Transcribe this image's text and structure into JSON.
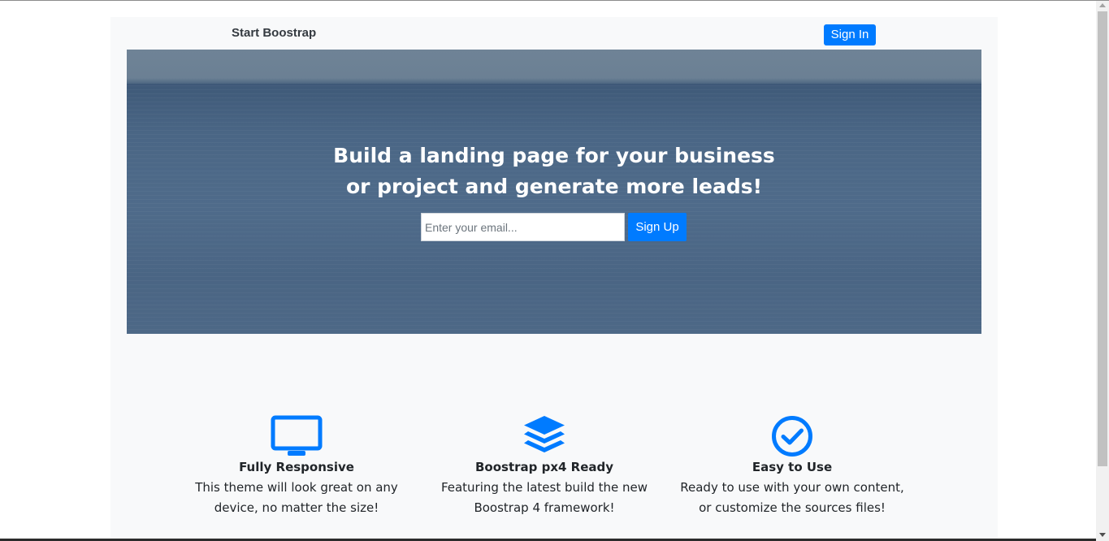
{
  "navbar": {
    "brand": "Start Boostrap",
    "signin_label": "Sign In"
  },
  "hero": {
    "headline_line1": "Build a landing page for your business",
    "headline_line2": "or project and generate more leads!",
    "email_placeholder": "Enter your email...",
    "signup_label": "Sign Up"
  },
  "features": [
    {
      "icon": "desktop-icon",
      "title": "Fully Responsive",
      "text": "This theme will look great on any device, no matter the size!"
    },
    {
      "icon": "layers-icon",
      "title": "Boostrap px4 Ready",
      "text": "Featuring the latest build the new Boostrap 4 framework!"
    },
    {
      "icon": "check-circle-icon",
      "title": "Easy to Use",
      "text": "Ready to use with your own content, or customize the sources files!"
    }
  ],
  "colors": {
    "accent": "#007bff",
    "page_bg": "#f8f9fa",
    "brand_text": "#343a40"
  }
}
